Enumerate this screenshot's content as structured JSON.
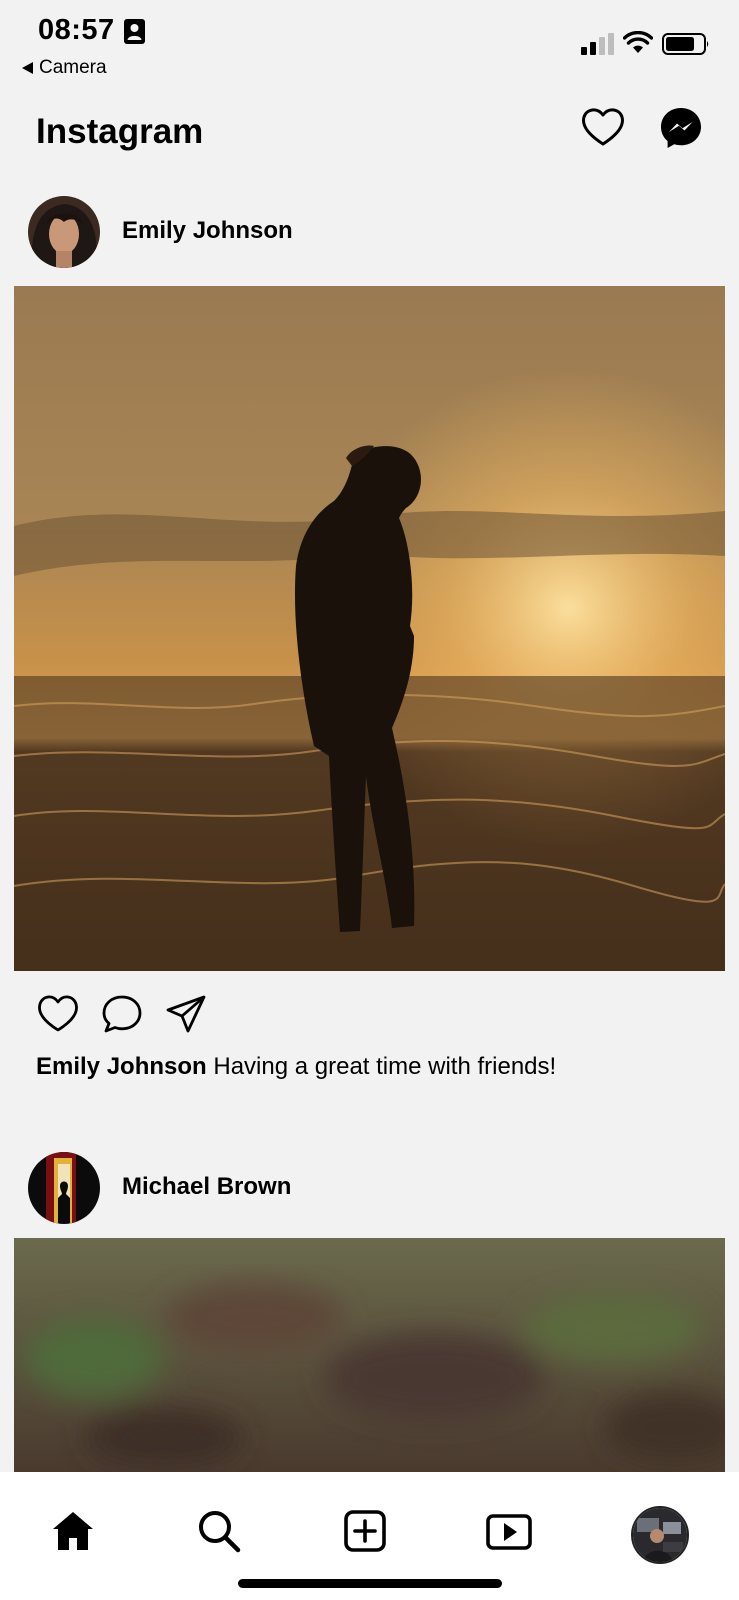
{
  "status_bar": {
    "time": "08:57",
    "back_label": "Camera",
    "icons": [
      "contact-card-icon",
      "signal-icon",
      "wifi-icon",
      "battery-icon"
    ]
  },
  "header": {
    "title": "Instagram",
    "icons": [
      "heart-icon",
      "messenger-icon"
    ]
  },
  "posts": [
    {
      "username": "Emily Johnson",
      "caption_user": "Emily Johnson",
      "caption_text": "Having a great time with friends!",
      "actions": [
        "heart-icon",
        "comment-icon",
        "share-icon"
      ]
    },
    {
      "username": "Michael Brown"
    }
  ],
  "bottom_nav": {
    "items": [
      "home-icon",
      "search-icon",
      "add-post-icon",
      "reels-icon",
      "profile-avatar"
    ]
  },
  "colors": {
    "background": "#f2f2f2",
    "nav_background": "#ffffff",
    "text": "#000000"
  }
}
